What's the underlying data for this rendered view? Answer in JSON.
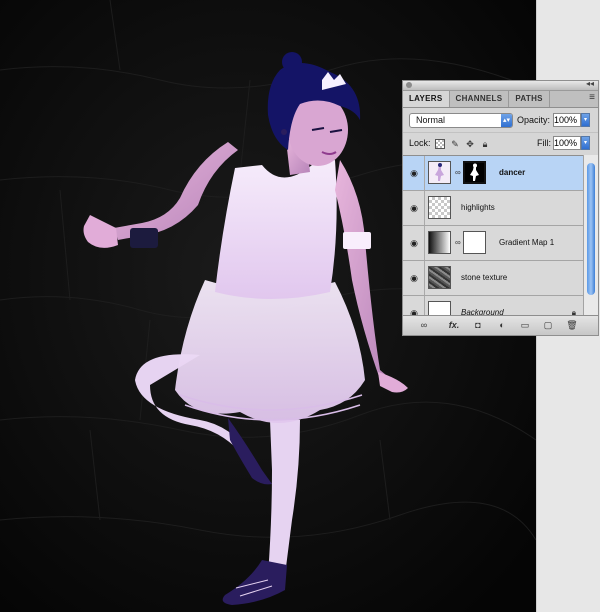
{
  "panel": {
    "tabs": [
      "LAYERS",
      "CHANNELS",
      "PATHS"
    ],
    "blend_mode": "Normal",
    "opacity_label": "Opacity:",
    "opacity_value": "100%",
    "lock_label": "Lock:",
    "fill_label": "Fill:",
    "fill_value": "100%",
    "layers": [
      {
        "name": "dancer",
        "selected": true,
        "visible": true
      },
      {
        "name": "highlights",
        "selected": false,
        "visible": true
      },
      {
        "name": "Gradient Map 1",
        "selected": false,
        "visible": true
      },
      {
        "name": "stone texture",
        "selected": false,
        "visible": true
      },
      {
        "name": "Background",
        "selected": false,
        "visible": true,
        "locked": true
      }
    ],
    "bottom_icons": [
      "link-layers-icon",
      "fx-icon",
      "add-mask-icon",
      "adjustment-layer-icon",
      "new-group-icon",
      "new-layer-icon",
      "trash-icon"
    ],
    "fx_label": "fx.",
    "accent": "#2f6fd1"
  }
}
